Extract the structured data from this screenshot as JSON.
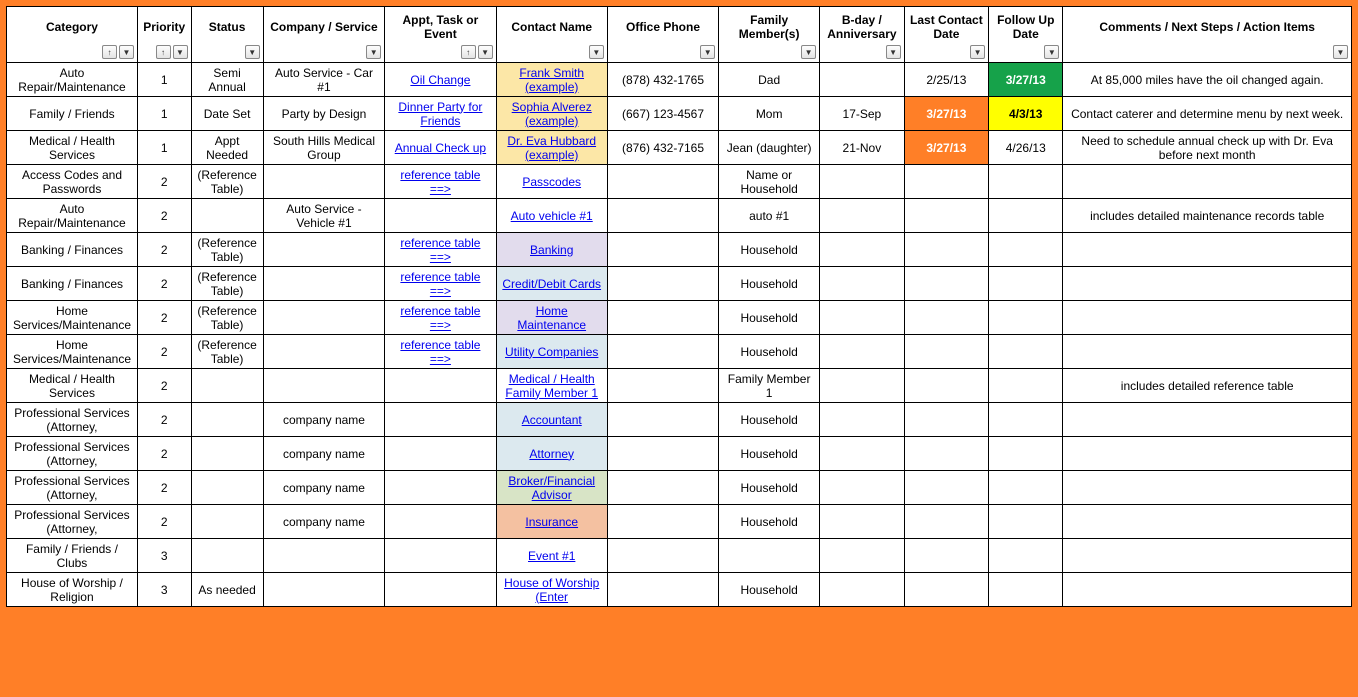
{
  "columns": [
    {
      "key": "category",
      "label": "Category",
      "sort": true,
      "filter": true
    },
    {
      "key": "priority",
      "label": "Priority",
      "sort": true,
      "filter": true
    },
    {
      "key": "status",
      "label": "Status",
      "sort": false,
      "filter": true
    },
    {
      "key": "company",
      "label": "Company / Service",
      "sort": false,
      "filter": true
    },
    {
      "key": "appt",
      "label": "Appt, Task or Event",
      "sort": true,
      "filter": true
    },
    {
      "key": "contact",
      "label": "Contact Name",
      "sort": false,
      "filter": true
    },
    {
      "key": "phone",
      "label": "Office Phone",
      "sort": false,
      "filter": true
    },
    {
      "key": "family",
      "label": "Family Member(s)",
      "sort": false,
      "filter": true
    },
    {
      "key": "bday",
      "label": "B-day / Anniversary",
      "sort": false,
      "filter": true
    },
    {
      "key": "last",
      "label": "Last Contact Date",
      "sort": false,
      "filter": true
    },
    {
      "key": "follow",
      "label": "Follow Up Date",
      "sort": false,
      "filter": true
    },
    {
      "key": "comments",
      "label": "Comments / Next Steps / Action Items",
      "sort": false,
      "filter": true
    }
  ],
  "rows": [
    {
      "category": "Auto Repair/Maintenance",
      "priority": "1",
      "status": "Semi Annual",
      "company": "Auto Service - Car #1",
      "appt": "Oil Change",
      "apptLink": true,
      "contact": "Frank Smith (example)",
      "contactHl": "hl-khaki",
      "phone": "(878) 432-1765",
      "family": "Dad",
      "bday": "",
      "last": "2/25/13",
      "lastCls": "",
      "follow": "3/27/13",
      "followCls": "bg-green",
      "comments": "At 85,000 miles have the oil changed again."
    },
    {
      "category": "Family / Friends",
      "priority": "1",
      "status": "Date Set",
      "company": "Party by Design",
      "appt": "Dinner Party for Friends",
      "apptLink": true,
      "contact": "Sophia Alverez (example)",
      "contactHl": "hl-khaki",
      "phone": "(667) 123-4567",
      "family": "Mom",
      "bday": "17-Sep",
      "last": "3/27/13",
      "lastCls": "bg-orange",
      "follow": "4/3/13",
      "followCls": "bg-yellow",
      "comments": "Contact caterer and determine menu by next week."
    },
    {
      "category": "Medical / Health Services",
      "priority": "1",
      "status": "Appt Needed",
      "company": "South Hills Medical Group",
      "appt": "Annual Check up",
      "apptLink": true,
      "contact": "Dr. Eva Hubbard (example)",
      "contactHl": "hl-khaki",
      "phone": "(876) 432-7165",
      "family": "Jean (daughter)",
      "bday": "21-Nov",
      "last": "3/27/13",
      "lastCls": "bg-orange",
      "follow": "4/26/13",
      "followCls": "",
      "comments": "Need to schedule annual check up with Dr. Eva before next month"
    },
    {
      "category": "Access Codes and Passwords",
      "priority": "2",
      "status": "(Reference Table)",
      "company": "",
      "appt": "reference table ==>",
      "apptLink": true,
      "contact": "Passcodes ",
      "contactHl": "",
      "phone": "",
      "family": "Name or Household",
      "bday": "",
      "last": "",
      "lastCls": "",
      "follow": "",
      "followCls": "",
      "comments": ""
    },
    {
      "category": "Auto Repair/Maintenance",
      "priority": "2",
      "status": "",
      "company": "Auto Service - Vehicle #1",
      "appt": "",
      "apptLink": false,
      "contact": "Auto vehicle #1",
      "contactHl": "",
      "phone": "",
      "family": "auto #1",
      "bday": "",
      "last": "",
      "lastCls": "",
      "follow": "",
      "followCls": "",
      "comments": "includes detailed maintenance records table"
    },
    {
      "category": "Banking / Finances",
      "priority": "2",
      "status": "(Reference Table)",
      "company": "",
      "appt": "reference table ==>",
      "apptLink": true,
      "contact": "Banking ",
      "contactHl": "hl-lav",
      "phone": "",
      "family": "Household",
      "bday": "",
      "last": "",
      "lastCls": "",
      "follow": "",
      "followCls": "",
      "comments": ""
    },
    {
      "category": "Banking / Finances",
      "priority": "2",
      "status": "(Reference Table)",
      "company": "",
      "appt": "reference table ==>",
      "apptLink": true,
      "contact": "Credit/Debit Cards ",
      "contactHl": "hl-ltblue",
      "phone": "",
      "family": "Household",
      "bday": "",
      "last": "",
      "lastCls": "",
      "follow": "",
      "followCls": "",
      "comments": ""
    },
    {
      "category": "Home Services/Maintenance",
      "priority": "2",
      "status": "(Reference Table)",
      "company": "",
      "appt": "reference table ==>",
      "apptLink": true,
      "contact": "Home Maintenance ",
      "contactHl": "hl-lav",
      "phone": "",
      "family": "Household",
      "bday": "",
      "last": "",
      "lastCls": "",
      "follow": "",
      "followCls": "",
      "comments": ""
    },
    {
      "category": "Home Services/Maintenance",
      "priority": "2",
      "status": "(Reference Table)",
      "company": "",
      "appt": "reference table ==>",
      "apptLink": true,
      "contact": "Utility Companies",
      "contactHl": "hl-ltblue",
      "phone": "",
      "family": "Household",
      "bday": "",
      "last": "",
      "lastCls": "",
      "follow": "",
      "followCls": "",
      "comments": ""
    },
    {
      "category": "Medical / Health Services",
      "priority": "2",
      "status": "",
      "company": "",
      "appt": "",
      "apptLink": false,
      "contact": "Medical / Health Family Member 1",
      "contactHl": "",
      "phone": "",
      "family": "Family Member 1",
      "bday": "",
      "last": "",
      "lastCls": "",
      "follow": "",
      "followCls": "",
      "comments": "includes detailed reference table"
    },
    {
      "category": "Professional Services (Attorney,",
      "priority": "2",
      "status": "",
      "company": "company name",
      "appt": "",
      "apptLink": false,
      "contact": "Accountant ",
      "contactHl": "hl-ltblue",
      "phone": "",
      "family": "Household",
      "bday": "",
      "last": "",
      "lastCls": "",
      "follow": "",
      "followCls": "",
      "comments": ""
    },
    {
      "category": "Professional Services (Attorney,",
      "priority": "2",
      "status": "",
      "company": "company name",
      "appt": "",
      "apptLink": false,
      "contact": "Attorney ",
      "contactHl": "hl-ltblue",
      "phone": "",
      "family": "Household",
      "bday": "",
      "last": "",
      "lastCls": "",
      "follow": "",
      "followCls": "",
      "comments": ""
    },
    {
      "category": "Professional Services (Attorney,",
      "priority": "2",
      "status": "",
      "company": "company name",
      "appt": "",
      "apptLink": false,
      "contact": "Broker/Financial Advisor ",
      "contactHl": "hl-ltgreen",
      "phone": "",
      "family": "Household",
      "bday": "",
      "last": "",
      "lastCls": "",
      "follow": "",
      "followCls": "",
      "comments": ""
    },
    {
      "category": "Professional Services (Attorney,",
      "priority": "2",
      "status": "",
      "company": "company name",
      "appt": "",
      "apptLink": false,
      "contact": "Insurance ",
      "contactHl": "hl-coral",
      "phone": "",
      "family": "Household",
      "bday": "",
      "last": "",
      "lastCls": "",
      "follow": "",
      "followCls": "",
      "comments": ""
    },
    {
      "category": "Family / Friends / Clubs",
      "priority": "3",
      "status": "",
      "company": "",
      "appt": "",
      "apptLink": false,
      "contact": "Event #1",
      "contactHl": "",
      "phone": "",
      "family": "",
      "bday": "",
      "last": "",
      "lastCls": "",
      "follow": "",
      "followCls": "",
      "comments": ""
    },
    {
      "category": "House of Worship / Religion",
      "priority": "3",
      "status": "As needed",
      "company": "",
      "appt": "",
      "apptLink": false,
      "contact": "House of Worship (Enter",
      "contactHl": "",
      "phone": "",
      "family": "Household",
      "bday": "",
      "last": "",
      "lastCls": "",
      "follow": "",
      "followCls": "",
      "comments": ""
    }
  ]
}
